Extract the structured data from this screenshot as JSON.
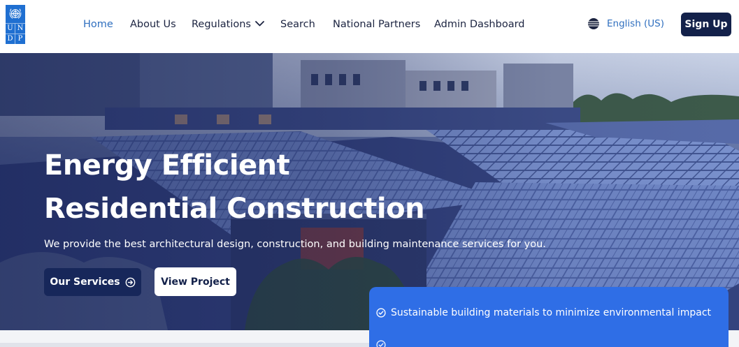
{
  "header": {
    "logo": {
      "name": "undp-logo",
      "letters": [
        "U",
        "N",
        "D",
        "P"
      ]
    },
    "nav": [
      {
        "label": "Home",
        "active": true
      },
      {
        "label": "About Us",
        "active": false
      },
      {
        "label": "Regulations",
        "active": false,
        "has_dropdown": true
      },
      {
        "label": "Search",
        "active": false
      },
      {
        "label": "National Partners",
        "active": false
      },
      {
        "label": "Admin Dashboard",
        "active": false
      }
    ],
    "language": {
      "label": "English (US)",
      "icon": "globe-icon"
    },
    "signup_label": "Sign Up"
  },
  "hero": {
    "title_line1": "Energy Efficient",
    "title_line2": "Residential Construction",
    "subtitle": "We provide the best architectural design, construction, and building maintenance services for you.",
    "primary_button": {
      "label": "Our Services",
      "icon": "arrow-circle-right-icon"
    },
    "secondary_button": {
      "label": "View Project"
    },
    "background_image": "solar-panel-rooftops-photo"
  },
  "features": [
    {
      "text": "Sustainable building materials to minimize environmental impact",
      "icon": "check-circle-icon"
    },
    {
      "text": "",
      "icon": "check-circle-icon"
    }
  ],
  "colors": {
    "navy": "#13214a",
    "active_link": "#2f6fbf",
    "feature_card": "#2f6ee6",
    "logo_blue": "#1f6fd1"
  }
}
